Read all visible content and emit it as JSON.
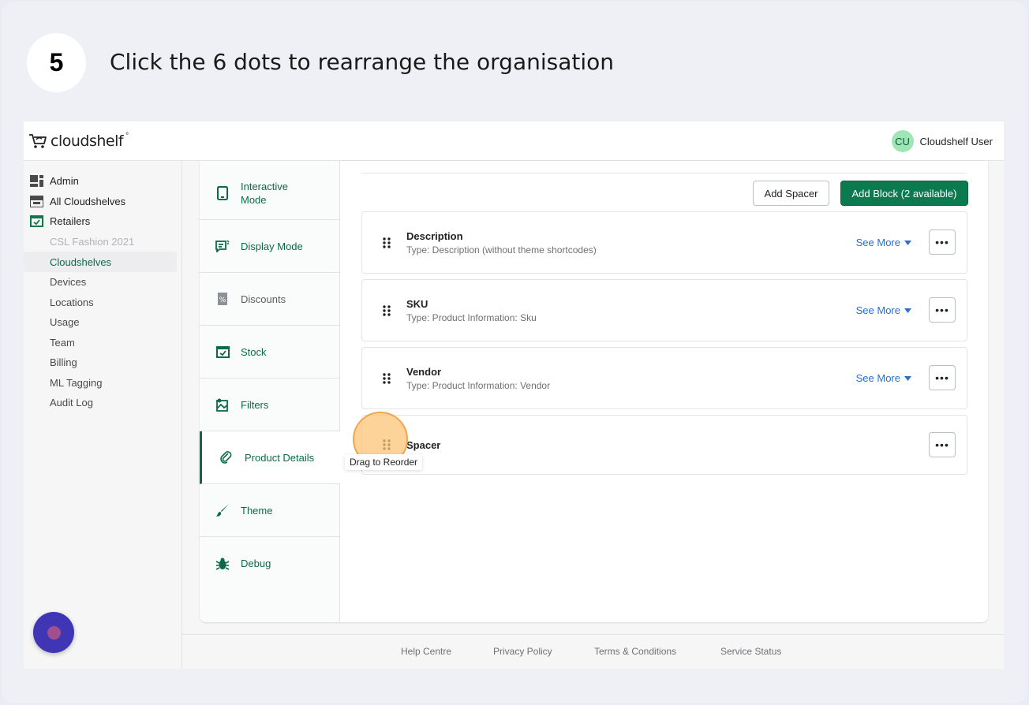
{
  "step": {
    "number": "5",
    "instruction": "Click the 6 dots to rearrange the organisation"
  },
  "header": {
    "logo_text": "cloudshelf",
    "logo_mark": "°",
    "avatar_initials": "CU",
    "user_name": "Cloudshelf User"
  },
  "sidebar": {
    "items": [
      {
        "label": "Admin",
        "icon": "admin-icon"
      },
      {
        "label": "All Cloudshelves",
        "icon": "store-icon"
      },
      {
        "label": "Retailers",
        "icon": "calendar-check-icon"
      }
    ],
    "subitems": [
      {
        "label": "CSL Fashion 2021",
        "state": "muted"
      },
      {
        "label": "Cloudshelves",
        "state": "active"
      },
      {
        "label": "Devices",
        "state": "normal"
      },
      {
        "label": "Locations",
        "state": "normal"
      },
      {
        "label": "Usage",
        "state": "normal"
      },
      {
        "label": "Team",
        "state": "normal"
      },
      {
        "label": "Billing",
        "state": "normal"
      },
      {
        "label": "ML Tagging",
        "state": "normal"
      },
      {
        "label": "Audit Log",
        "state": "normal"
      }
    ]
  },
  "tabs": [
    {
      "label": "Interactive\nMode",
      "icon": "tablet-icon"
    },
    {
      "label": "Display Mode",
      "icon": "display-icon"
    },
    {
      "label": "Discounts",
      "icon": "discount-icon"
    },
    {
      "label": "Stock",
      "icon": "stock-icon"
    },
    {
      "label": "Filters",
      "icon": "filter-icon"
    },
    {
      "label": "Product Details",
      "icon": "link-icon",
      "active": true
    },
    {
      "label": "Theme",
      "icon": "brush-icon"
    },
    {
      "label": "Debug",
      "icon": "bug-icon"
    }
  ],
  "toolbar": {
    "add_spacer": "Add Spacer",
    "add_block": "Add Block (2 available)"
  },
  "blocks": [
    {
      "title": "Description",
      "type": "Type: Description (without theme shortcodes)",
      "see_more": "See More"
    },
    {
      "title": "SKU",
      "type": "Type: Product Information: Sku",
      "see_more": "See More"
    },
    {
      "title": "Vendor",
      "type": "Type: Product Information: Vendor",
      "see_more": "See More"
    },
    {
      "title": "Spacer"
    }
  ],
  "more_label": "•••",
  "tooltip": "Drag to Reorder",
  "footer": {
    "links": [
      "Help Centre",
      "Privacy Policy",
      "Terms & Conditions",
      "Service Status"
    ]
  },
  "colors": {
    "brand_green": "#0b7a4f",
    "link_blue": "#2c6ecb",
    "highlight": "#f2a64a"
  }
}
